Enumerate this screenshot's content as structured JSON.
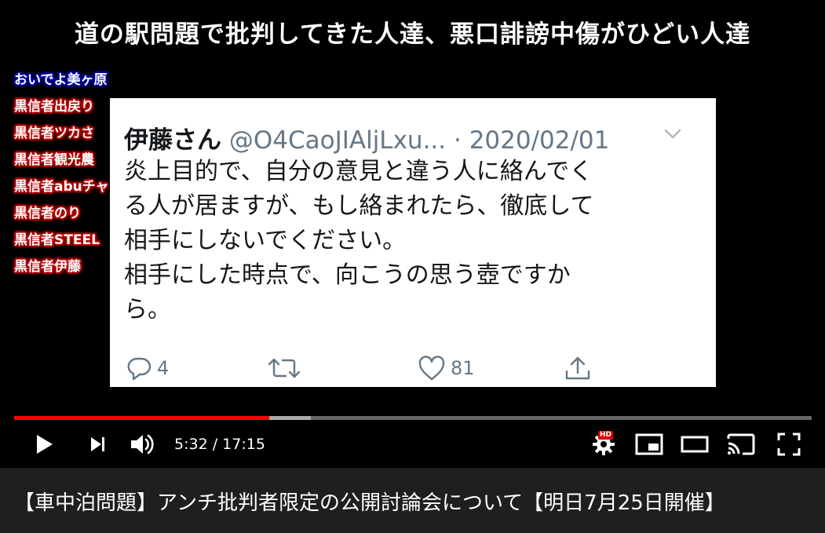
{
  "banner": {
    "text": "道の駅問題で批判してきた人達、悪口誹謗中傷がひどい人達"
  },
  "sidebar": {
    "items": [
      {
        "label": "おいでよ美ヶ原"
      },
      {
        "label": "黒信者出戻り"
      },
      {
        "label": "黒信者ツカさ"
      },
      {
        "label": "黒信者観光農"
      },
      {
        "label": "黒信者abuチャ"
      },
      {
        "label": "黒信者のり"
      },
      {
        "label": "黒信者STEEL"
      },
      {
        "label": "黒信者伊藤"
      }
    ]
  },
  "tweet": {
    "author": "伊藤さん",
    "handle": "@O4CaoJIAljLxu...",
    "date": "· 2020/02/01",
    "body_lines": [
      "炎上目的で、自分の意見と違う人に絡んでく",
      "る人が居ますが、もし絡まれたら、徹底して",
      "相手にしないでください。",
      "相手にした時点で、向こうの思う壺ですか",
      "ら。"
    ],
    "reply_count": "4",
    "retweet_count": "",
    "like_count": "81",
    "icons": {
      "reply": "reply-icon",
      "retweet": "retweet-icon",
      "like": "heart-icon",
      "share": "share-icon",
      "menu": "chevron-down-icon"
    }
  },
  "player": {
    "progress_fraction": 0.3198,
    "buffer_fraction": 0.372,
    "time": "5:32 / 17:15",
    "settings_badge": "HD",
    "accent_color": "#ff0000",
    "icons": {
      "play": "play-icon",
      "next": "next-icon",
      "volume": "volume-icon",
      "settings": "gear-icon",
      "miniplayer": "miniplayer-icon",
      "theater": "theater-icon",
      "cast": "cast-icon",
      "fullscreen": "fullscreen-icon"
    }
  },
  "video": {
    "title": "【車中泊問題】アンチ批判者限定の公開討論会について【明日7月25日開催】"
  }
}
